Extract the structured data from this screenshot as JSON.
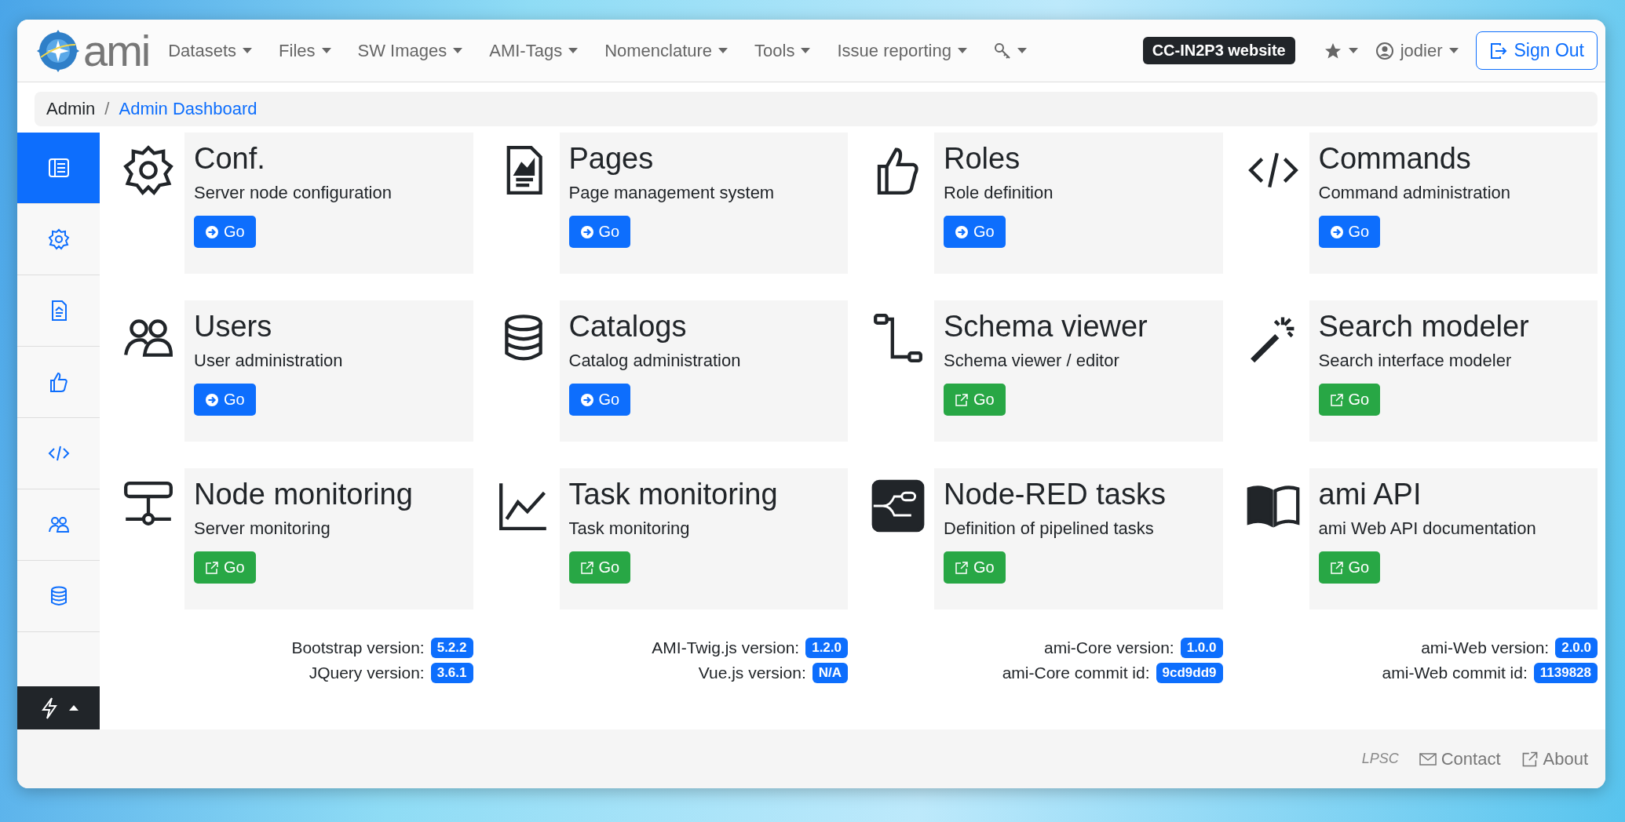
{
  "navbar": {
    "brand": "ami",
    "menus": [
      {
        "label": "Datasets"
      },
      {
        "label": "Files"
      },
      {
        "label": "SW Images"
      },
      {
        "label": "AMI-Tags"
      },
      {
        "label": "Nomenclature"
      },
      {
        "label": "Tools"
      },
      {
        "label": "Issue reporting",
        "kind": "text"
      },
      {
        "kind": "key"
      }
    ],
    "website_badge": "CC-IN2P3 website",
    "user": "jodier",
    "sign_out": "Sign Out"
  },
  "breadcrumb": {
    "separator": "/",
    "items": [
      {
        "label": "Admin",
        "kind": "text"
      },
      {
        "label": "Admin Dashboard",
        "kind": "link"
      }
    ]
  },
  "sidebar": {
    "items": [
      {
        "selected": true
      },
      {
        "selected": false
      },
      {
        "selected": false
      },
      {
        "selected": false
      },
      {
        "selected": false
      },
      {
        "selected": false
      },
      {
        "selected": false
      }
    ]
  },
  "cards": [
    {
      "title": "Conf.",
      "description": "Server node configuration",
      "button": {
        "label": "Go",
        "kind": "internal"
      }
    },
    {
      "title": "Pages",
      "description": "Page management system",
      "button": {
        "label": "Go",
        "kind": "internal"
      }
    },
    {
      "title": "Roles",
      "description": "Role definition",
      "button": {
        "label": "Go",
        "kind": "internal"
      }
    },
    {
      "title": "Commands",
      "description": "Command administration",
      "button": {
        "label": "Go",
        "kind": "internal"
      }
    },
    {
      "title": "Users",
      "description": "User administration",
      "button": {
        "label": "Go",
        "kind": "internal"
      }
    },
    {
      "title": "Catalogs",
      "description": "Catalog administration",
      "button": {
        "label": "Go",
        "kind": "internal"
      }
    },
    {
      "title": "Schema viewer",
      "description": "Schema viewer / editor",
      "button": {
        "label": "Go",
        "kind": "external"
      }
    },
    {
      "title": "Search modeler",
      "description": "Search interface modeler",
      "button": {
        "label": "Go",
        "kind": "external"
      }
    },
    {
      "title": "Node monitoring",
      "description": "Server monitoring",
      "button": {
        "label": "Go",
        "kind": "external"
      }
    },
    {
      "title": "Task monitoring",
      "description": "Task monitoring",
      "button": {
        "label": "Go",
        "kind": "external"
      }
    },
    {
      "title": "Node-RED tasks",
      "description": "Definition of pipelined tasks",
      "button": {
        "label": "Go",
        "kind": "external"
      }
    },
    {
      "title": "ami API",
      "description": "ami Web API documentation",
      "button": {
        "label": "Go",
        "kind": "external"
      }
    }
  ],
  "versions": [
    [
      {
        "label": "Bootstrap version:",
        "value": "5.2.2"
      },
      {
        "label": "JQuery version:",
        "value": "3.6.1"
      }
    ],
    [
      {
        "label": "AMI-Twig.js version:",
        "value": "1.2.0"
      },
      {
        "label": "Vue.js version:",
        "value": "N/A"
      }
    ],
    [
      {
        "label": "ami-Core version:",
        "value": "1.0.0"
      },
      {
        "label": "ami-Core commit id:",
        "value": "9cd9dd9"
      }
    ],
    [
      {
        "label": "ami-Web version:",
        "value": "2.0.0"
      },
      {
        "label": "ami-Web commit id:",
        "value": "1139828"
      }
    ]
  ],
  "footer": {
    "logo": "LPSC",
    "links": [
      {
        "label": "Contact",
        "kind": "mail"
      },
      {
        "label": "About",
        "kind": "external"
      }
    ]
  }
}
